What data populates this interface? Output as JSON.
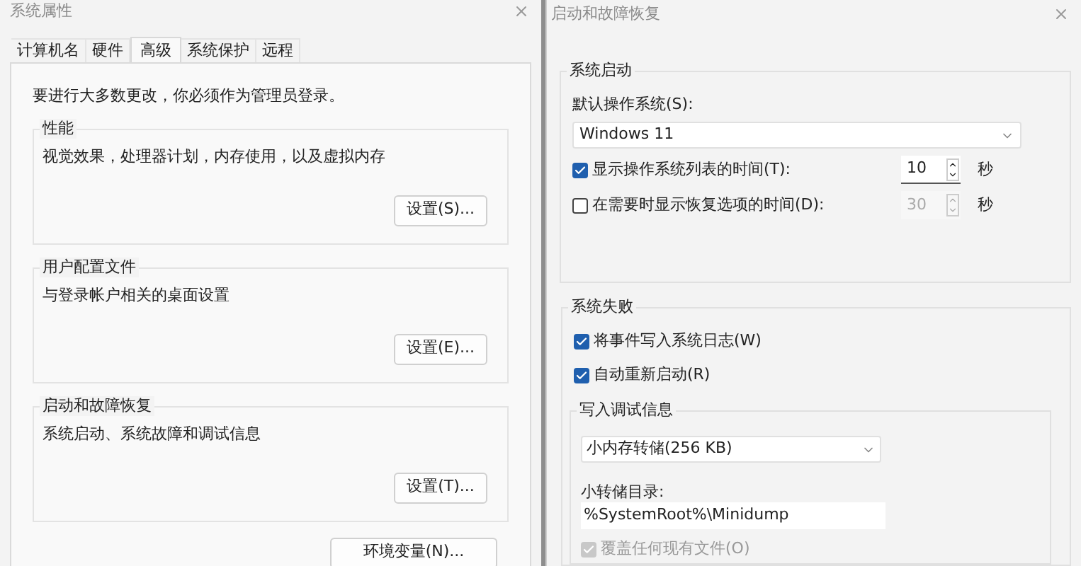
{
  "left_window": {
    "title": "系统属性",
    "tabs": [
      {
        "label": "计算机名",
        "selected": false
      },
      {
        "label": "硬件",
        "selected": false
      },
      {
        "label": "高级",
        "selected": true
      },
      {
        "label": "系统保护",
        "selected": false
      },
      {
        "label": "远程",
        "selected": false
      }
    ],
    "notice": "要进行大多数更改，你必须作为管理员登录。",
    "groups": [
      {
        "legend": "性能",
        "description": "视觉效果，处理器计划，内存使用，以及虚拟内存",
        "button": "设置(S)..."
      },
      {
        "legend": "用户配置文件",
        "description": "与登录帐户相关的桌面设置",
        "button": "设置(E)..."
      },
      {
        "legend": "启动和故障恢复",
        "description": "系统启动、系统故障和调试信息",
        "button": "设置(T)..."
      }
    ],
    "footer_button": "环境变量(N)..."
  },
  "right_window": {
    "title": "启动和故障恢复",
    "startup": {
      "legend": "系统启动",
      "default_os_label": "默认操作系统(S):",
      "default_os": "Windows 11",
      "options": [
        {
          "label": "显示操作系统列表的时间(T):",
          "checked": true,
          "value": "10",
          "unit": "秒"
        },
        {
          "label": "在需要时显示恢复选项的时间(D):",
          "checked": false,
          "value": "30",
          "unit": "秒"
        }
      ]
    },
    "failure": {
      "legend": "系统失败",
      "options": [
        {
          "label": "将事件写入系统日志(W)",
          "checked": true,
          "disabled": false
        },
        {
          "label": "自动重新启动(R)",
          "checked": true,
          "disabled": false
        }
      ],
      "debug": {
        "legend": "写入调试信息",
        "dump_type": "小内存转储(256 KB)",
        "dir_label": "小转储目录:",
        "dir_value": "%SystemRoot%\\Minidump",
        "overwrite": {
          "label": "覆盖任何现有文件(O)",
          "checked": true,
          "disabled": true
        }
      }
    }
  }
}
